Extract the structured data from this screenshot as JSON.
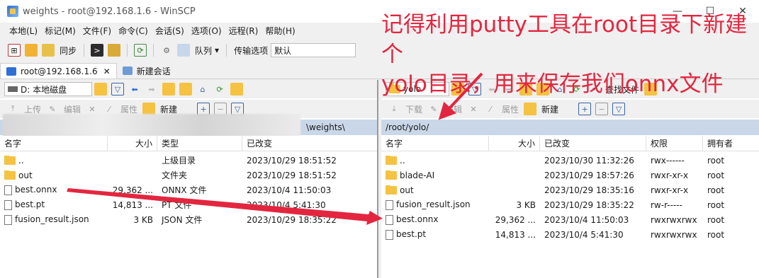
{
  "window": {
    "title": "weights - root@192.168.1.6 - WinSCP",
    "controls": [
      "—",
      "☐",
      "✕"
    ]
  },
  "menu": [
    "本地(L)",
    "标记(M)",
    "文件(F)",
    "命令(C)",
    "会话(S)",
    "选项(O)",
    "远程(R)",
    "帮助(H)"
  ],
  "toolbar": {
    "sync_label": "同步",
    "queue_label": "队列",
    "transfer_options_label": "传输选项",
    "transfer_preset": "默认"
  },
  "tabs": {
    "session": "root@192.168.1.6",
    "new_session": "新建会话"
  },
  "left": {
    "drive": "D: 本地磁盘",
    "upload": "上传",
    "edit": "编辑",
    "properties": "属性",
    "new": "新建",
    "path": "\\weights\\",
    "headers": {
      "name": "名字",
      "size": "大小",
      "type": "类型",
      "changed": "已改变"
    },
    "files": [
      {
        "name": "..",
        "size": "",
        "type": "上级目录",
        "changed": "2023/10/29   18:51:52",
        "icon": "folder-up-icon"
      },
      {
        "name": "out",
        "size": "",
        "type": "文件夹",
        "changed": "2023/10/29   18:51:52",
        "icon": "folder-icon"
      },
      {
        "name": "best.onnx",
        "size": "29,362 ...",
        "type": "ONNX 文件",
        "changed": "2023/10/4   11:50:03",
        "icon": "file-icon"
      },
      {
        "name": "best.pt",
        "size": "14,813 ...",
        "type": "PT 文件",
        "changed": "2023/10/4   5:41:30",
        "icon": "file-icon"
      },
      {
        "name": "fusion_result.json",
        "size": "3 KB",
        "type": "JSON 文件",
        "changed": "2023/10/29   18:35:22",
        "icon": "file-icon"
      }
    ]
  },
  "right": {
    "drive": "yolo",
    "download": "下载",
    "edit": "编辑",
    "properties": "属性",
    "new": "新建",
    "find": "查找文件",
    "path": "/root/yolo/",
    "headers": {
      "name": "名字",
      "size": "大小",
      "changed": "已改变",
      "rights": "权限",
      "owner": "拥有者"
    },
    "files": [
      {
        "name": "..",
        "size": "",
        "changed": "2023/10/30 11:32:26",
        "rights": "rwx------",
        "owner": "root",
        "icon": "folder-up-icon"
      },
      {
        "name": "blade-AI",
        "size": "",
        "changed": "2023/10/29 18:57:26",
        "rights": "rwxr-xr-x",
        "owner": "root",
        "icon": "folder-icon"
      },
      {
        "name": "out",
        "size": "",
        "changed": "2023/10/29 18:35:16",
        "rights": "rwxr-xr-x",
        "owner": "root",
        "icon": "folder-icon"
      },
      {
        "name": "fusion_result.json",
        "size": "3 KB",
        "changed": "2023/10/29 18:35:22",
        "rights": "rw-r-----",
        "owner": "root",
        "icon": "file-icon"
      },
      {
        "name": "best.onnx",
        "size": "29,362 ...",
        "changed": "2023/10/4 11:50:03",
        "rights": "rwxrwxrwx",
        "owner": "root",
        "icon": "file-icon"
      },
      {
        "name": "best.pt",
        "size": "14,813 ...",
        "changed": "2023/10/4 5:41:30",
        "rights": "rwxrwxrwx",
        "owner": "root",
        "icon": "file-icon"
      }
    ]
  },
  "annotation": {
    "line1": "记得利用putty工具在root目录下新建个",
    "line2": "yolo目录，用来保存我们onnx文件",
    "color": "#e3263f"
  }
}
